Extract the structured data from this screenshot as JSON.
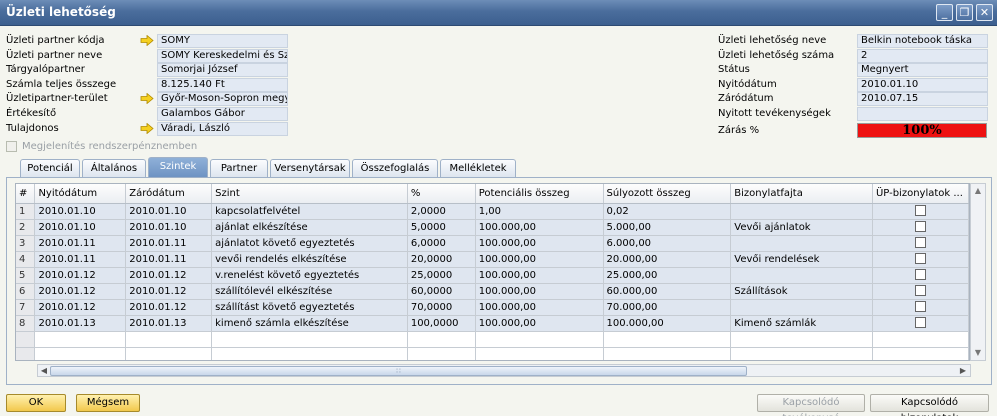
{
  "window": {
    "title": "Üzleti lehetőség",
    "minimize_icon": "_",
    "restore_icon": "❐",
    "close_icon": "✕"
  },
  "left_fields": [
    {
      "label": "Üzleti partner kódja",
      "value": "SOMY",
      "arrow": true
    },
    {
      "label": "Üzleti partner neve",
      "value": "SOMY Kereskedelmi és Szolg",
      "arrow": false
    },
    {
      "label": "Tárgyalópartner",
      "value": "Somorjai József",
      "arrow": false
    },
    {
      "label": "Számla teljes összege",
      "value": "8.125.140 Ft",
      "arrow": false
    },
    {
      "label": "Üzletipartner-terület",
      "value": "Győr-Moson-Sopron megye",
      "arrow": true
    },
    {
      "label": "Értékesítő",
      "value": "Galambos Gábor",
      "arrow": false
    },
    {
      "label": "Tulajdonos",
      "value": "Váradi, László",
      "arrow": true
    }
  ],
  "right_fields": [
    {
      "label": "Üzleti lehetőség neve",
      "value": "Belkin notebook táska"
    },
    {
      "label": "Üzleti lehetőség száma",
      "value": "2"
    },
    {
      "label": "Státus",
      "value": "Megnyert"
    },
    {
      "label": "Nyitódátum",
      "value": "2010.01.10"
    },
    {
      "label": "Záródátum",
      "value": "2010.07.15"
    },
    {
      "label": "Nyitott tevékenységek",
      "value": ""
    }
  ],
  "closing": {
    "label": "Zárás %",
    "value": "100%",
    "percent": 100,
    "color": "#ee1111"
  },
  "local_currency_checkbox": {
    "label": "Megjelenítés rendszerpénznemben",
    "checked": false
  },
  "tabs": [
    {
      "label": "Potenciál",
      "active": false
    },
    {
      "label": "Általános",
      "active": false
    },
    {
      "label": "Szintek",
      "active": true
    },
    {
      "label": "Partner",
      "active": false
    },
    {
      "label": "Versenytársak",
      "active": false
    },
    {
      "label": "Összefoglalás",
      "active": false
    },
    {
      "label": "Mellékletek",
      "active": false
    }
  ],
  "table": {
    "columns": [
      "#",
      "Nyitódátum",
      "Záródátum",
      "Szint",
      "%",
      "Potenciális összeg",
      "Súlyozott összeg",
      "Bizonylatfajta",
      "ÜP-bizonylatok ..."
    ],
    "rows": [
      [
        "1",
        "2010.01.10",
        "2010.01.10",
        "kapcsolatfelvétel",
        "2,0000",
        "1,00",
        "0,02",
        "",
        ""
      ],
      [
        "2",
        "2010.01.10",
        "2010.01.10",
        "ajánlat elkészítése",
        "5,0000",
        "100.000,00",
        "5.000,00",
        "Vevői ajánlatok",
        ""
      ],
      [
        "3",
        "2010.01.11",
        "2010.01.11",
        "ajánlatot követő egyeztetés",
        "6,0000",
        "100.000,00",
        "6.000,00",
        "",
        ""
      ],
      [
        "4",
        "2010.01.11",
        "2010.01.11",
        "vevői rendelés elkészítése",
        "20,0000",
        "100.000,00",
        "20.000,00",
        "Vevői rendelések",
        ""
      ],
      [
        "5",
        "2010.01.12",
        "2010.01.12",
        "v.renelést követő egyeztetés",
        "25,0000",
        "100.000,00",
        "25.000,00",
        "",
        ""
      ],
      [
        "6",
        "2010.01.12",
        "2010.01.12",
        "szállítólevél elkészítése",
        "60,0000",
        "100.000,00",
        "60.000,00",
        "Szállítások",
        ""
      ],
      [
        "7",
        "2010.01.12",
        "2010.01.12",
        "szállítást követő egyeztetés",
        "70,0000",
        "100.000,00",
        "70.000,00",
        "",
        ""
      ],
      [
        "8",
        "2010.01.13",
        "2010.01.13",
        "kimenő számla elkészítése",
        "100,0000",
        "100.000,00",
        "100.000,00",
        "Kimenő számlák",
        ""
      ]
    ],
    "empty_rows": 2,
    "scroll_grip": "∷",
    "arrow_up": "▲",
    "arrow_down": "▼",
    "arrow_left": "◀",
    "arrow_right": "▶"
  },
  "buttons": {
    "ok": "OK",
    "cancel": "Mégsem",
    "related_activities": "Kapcsolódó tevékenysé",
    "related_documents": "Kapcsolódó bizonylatok"
  }
}
